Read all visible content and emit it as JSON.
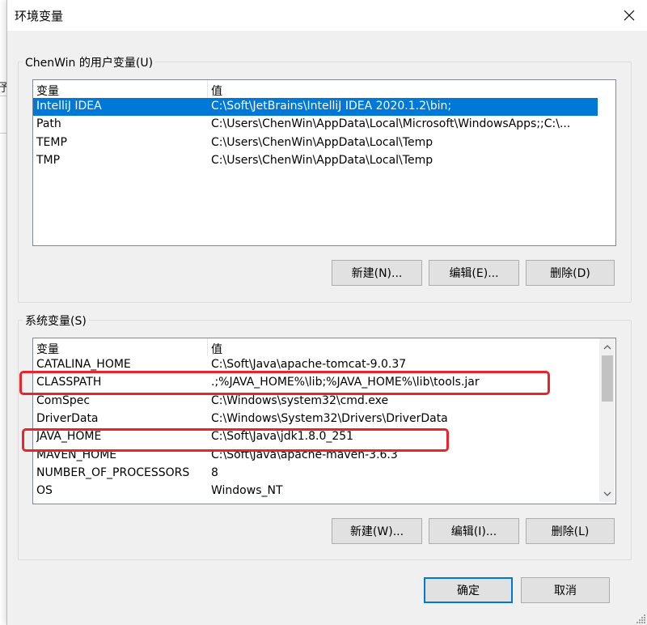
{
  "window": {
    "title": "环境变量",
    "close_icon": "close-icon"
  },
  "user_vars": {
    "group_label": "ChenWin 的用户变量(U)",
    "headers": {
      "name": "变量",
      "value": "值"
    },
    "rows": [
      {
        "name": "IntelliJ IDEA",
        "value": "C:\\Soft\\JetBrains\\IntelliJ IDEA 2020.1.2\\bin;"
      },
      {
        "name": "Path",
        "value": "C:\\Users\\ChenWin\\AppData\\Local\\Microsoft\\WindowsApps;;C:\\..."
      },
      {
        "name": "TEMP",
        "value": "C:\\Users\\ChenWin\\AppData\\Local\\Temp"
      },
      {
        "name": "TMP",
        "value": "C:\\Users\\ChenWin\\AppData\\Local\\Temp"
      }
    ],
    "selected_index": 0,
    "buttons": {
      "new": "新建(N)...",
      "edit": "编辑(E)...",
      "delete": "删除(D)"
    }
  },
  "system_vars": {
    "group_label": "系统变量(S)",
    "headers": {
      "name": "变量",
      "value": "值"
    },
    "rows": [
      {
        "name": "CATALINA_HOME",
        "value": "C:\\Soft\\Java\\apache-tomcat-9.0.37"
      },
      {
        "name": "CLASSPATH",
        "value": ".;%JAVA_HOME%\\lib;%JAVA_HOME%\\lib\\tools.jar"
      },
      {
        "name": "ComSpec",
        "value": "C:\\Windows\\system32\\cmd.exe"
      },
      {
        "name": "DriverData",
        "value": "C:\\Windows\\System32\\Drivers\\DriverData"
      },
      {
        "name": "JAVA_HOME",
        "value": "C:\\Soft\\Java\\jdk1.8.0_251"
      },
      {
        "name": "MAVEN_HOME",
        "value": "C:\\Soft\\Java\\apache-maven-3.6.3"
      },
      {
        "name": "NUMBER_OF_PROCESSORS",
        "value": "8"
      },
      {
        "name": "OS",
        "value": "Windows_NT"
      }
    ],
    "highlighted_rows": [
      "CLASSPATH",
      "JAVA_HOME"
    ],
    "highlight_color": "#e8242c",
    "buttons": {
      "new": "新建(W)...",
      "edit": "编辑(I)...",
      "delete": "删除(L)"
    }
  },
  "footer": {
    "ok": "确定",
    "cancel": "取消"
  },
  "colors": {
    "selection": "#0078d7",
    "dialog_bg": "#f0f0f0"
  }
}
